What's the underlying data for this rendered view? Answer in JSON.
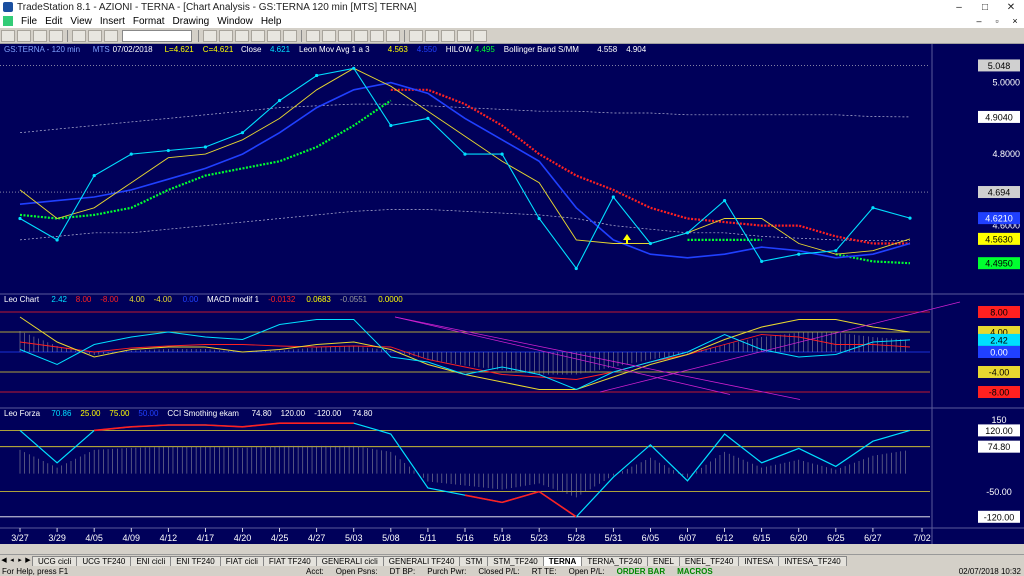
{
  "window": {
    "title": "TradeStation 8.1 - AZIONI - TERNA - [Chart Analysis - GS:TERNA  120 min  [MTS] TERNA]",
    "buttons": [
      "–",
      "□",
      "✕"
    ]
  },
  "menu": [
    "File",
    "Edit",
    "View",
    "Insert",
    "Format",
    "Drawing",
    "Window",
    "Help"
  ],
  "mdi_buttons": [
    "–",
    "▫",
    "×"
  ],
  "colors": {
    "background": "#00005a",
    "price": "#00e0ff",
    "green": "#00ff30",
    "red": "#ff2020",
    "blue": "#2040ff",
    "yellow": "#e8d830",
    "magenta": "#d020d0",
    "axis_text": "#ffffff"
  },
  "legends": {
    "price": [
      {
        "text": "GS:TERNA - 120 min",
        "color": "#7fa0ff"
      },
      {
        "text": "MTS",
        "color": "#7fa0ff"
      },
      {
        "text": "07/02/2018",
        "color": "#ffffff"
      },
      {
        "text": "L=4.621",
        "color": "#ffff00"
      },
      {
        "text": "C=4.621",
        "color": "#ffff00"
      },
      {
        "text": "Close",
        "color": "#ffffff"
      },
      {
        "text": "4.621",
        "color": "#00e0ff"
      },
      {
        "text": "Leon Mov Avg 1 a 3",
        "color": "#ffffff"
      },
      {
        "text": "4.563",
        "color": "#ffff00"
      },
      {
        "text": "4.550",
        "color": "#2040ff"
      },
      {
        "text": "HILOW",
        "color": "#ffffff"
      },
      {
        "text": "4.495",
        "color": "#00ff30"
      },
      {
        "text": "Bollinger Band S/MM",
        "color": "#ffffff"
      },
      {
        "text": "4.558",
        "color": "#ffffff"
      },
      {
        "text": "4.904",
        "color": "#ffffff"
      }
    ],
    "leo_chart": [
      {
        "text": "Leo Chart",
        "color": "#ffffff"
      },
      {
        "text": "2.42",
        "color": "#00e0ff"
      },
      {
        "text": "8.00",
        "color": "#ff2020"
      },
      {
        "text": "-8.00",
        "color": "#ff2020"
      },
      {
        "text": "4.00",
        "color": "#e8d830"
      },
      {
        "text": "-4.00",
        "color": "#e8d830"
      },
      {
        "text": "0.00",
        "color": "#2040ff"
      },
      {
        "text": "MACD modif 1",
        "color": "#ffffff"
      },
      {
        "text": "-0.0132",
        "color": "#ff2020"
      },
      {
        "text": "0.0683",
        "color": "#ffff00"
      },
      {
        "text": "-0.0551",
        "color": "#9a9a9a"
      },
      {
        "text": "0.0000",
        "color": "#ffff00"
      }
    ],
    "leo_forza": [
      {
        "text": "Leo Forza",
        "color": "#ffffff"
      },
      {
        "text": "70.86",
        "color": "#00e0ff"
      },
      {
        "text": "25.00",
        "color": "#ffff00"
      },
      {
        "text": "75.00",
        "color": "#ffff00"
      },
      {
        "text": "50.00",
        "color": "#2040ff"
      },
      {
        "text": "CCI Smothing ekam",
        "color": "#ffffff"
      },
      {
        "text": "74.80",
        "color": "#ffffff"
      },
      {
        "text": "120.00",
        "color": "#ffffff"
      },
      {
        "text": "-120.00",
        "color": "#ffffff"
      },
      {
        "text": "74.80",
        "color": "#ffffff"
      }
    ]
  },
  "price_axis": [
    "5.0000",
    "4.8000",
    "4.7000"
  ],
  "price_axis_extra": [
    "4.6000"
  ],
  "price_marks": [
    {
      "text": "5.048",
      "color": "#000000",
      "bg": "#d0d0d0",
      "y": 5.048
    },
    {
      "text": "4.694",
      "color": "#000000",
      "bg": "#d0d0d0",
      "y": 4.694
    },
    {
      "text": "4.9040",
      "color": "#000000",
      "bg": "#ffffff",
      "y": 4.904
    },
    {
      "text": "4.6210",
      "color": "#ffffff",
      "bg": "#2040ff",
      "y": 4.621
    },
    {
      "text": "4.5630",
      "color": "#000000",
      "bg": "#ffff00",
      "y": 4.563
    },
    {
      "text": "4.4950",
      "color": "#000000",
      "bg": "#00ff30",
      "y": 4.495
    }
  ],
  "leo_axis_marks": [
    {
      "text": "8.00",
      "color": "#000000",
      "bg": "#ff2020",
      "y": 8
    },
    {
      "text": "4.00",
      "color": "#000000",
      "bg": "#e8d830",
      "y": 4
    },
    {
      "text": "2.42",
      "color": "#000000",
      "bg": "#00e0ff",
      "y": 2.42
    },
    {
      "text": "0.00",
      "color": "#ffffff",
      "bg": "#2040ff",
      "y": 0
    },
    {
      "text": "-4.00",
      "color": "#000000",
      "bg": "#e8d830",
      "y": -4
    },
    {
      "text": "-8.00",
      "color": "#000000",
      "bg": "#ff2020",
      "y": -8
    }
  ],
  "forza_axis_marks": [
    {
      "text": "150",
      "color": "#ffffff",
      "bg": "",
      "y": 150
    },
    {
      "text": "120.00",
      "color": "#000000",
      "bg": "#ffffff",
      "y": 120
    },
    {
      "text": "74.80",
      "color": "#000000",
      "bg": "#ffffff",
      "y": 74.8
    },
    {
      "text": "-50.00",
      "color": "#ffffff",
      "bg": "",
      "y": -50
    },
    {
      "text": "-120.00",
      "color": "#000000",
      "bg": "#ffffff",
      "y": -120
    }
  ],
  "dates": [
    "3/27",
    "3/29",
    "4/05",
    "4/09",
    "4/12",
    "4/17",
    "4/20",
    "4/25",
    "4/27",
    "5/03",
    "5/08",
    "5/11",
    "5/16",
    "5/18",
    "5/23",
    "5/28",
    "5/31",
    "6/05",
    "6/07",
    "6/12",
    "6/15",
    "6/20",
    "6/25",
    "6/27",
    "7/02"
  ],
  "tabs": [
    "UCG cicli",
    "UCG TF240",
    "ENI cicli",
    "ENI TF240",
    "FIAT cicli",
    "FIAT TF240",
    "GENERALI cicli",
    "GENERALI TF240",
    "STM",
    "STM_TF240",
    "TERNA",
    "TERNA_TF240",
    "ENEL",
    "ENEL_TF240",
    "INTESA",
    "INTESA_TF240"
  ],
  "active_tab": "TERNA",
  "status": {
    "help": "For Help, press F1",
    "fields": [
      "Acct:",
      "Open Psns:",
      "DT BP:",
      "Purch Pwr:",
      "Closed P/L:",
      "RT TE:",
      "Open P/L:"
    ],
    "order_bar": "ORDER BAR",
    "macros": "MACROS",
    "clock": "02/07/2018 10:32"
  },
  "chart_data": [
    {
      "type": "line",
      "title": "GS:TERNA - 120 min",
      "x": [
        "3/27",
        "3/29",
        "4/05",
        "4/09",
        "4/12",
        "4/17",
        "4/20",
        "4/25",
        "4/27",
        "5/03",
        "5/08",
        "5/11",
        "5/16",
        "5/18",
        "5/23",
        "5/28",
        "5/31",
        "6/05",
        "6/07",
        "6/12",
        "6/15",
        "6/20",
        "6/25",
        "6/27",
        "7/02"
      ],
      "ylim": [
        4.42,
        5.08
      ],
      "series": [
        {
          "name": "Close",
          "values": [
            4.62,
            4.56,
            4.74,
            4.8,
            4.81,
            4.82,
            4.86,
            4.95,
            5.02,
            5.04,
            4.88,
            4.9,
            4.8,
            4.8,
            4.62,
            4.48,
            4.68,
            4.55,
            4.58,
            4.67,
            4.5,
            4.52,
            4.53,
            4.65,
            4.621
          ]
        },
        {
          "name": "Leon Mov Avg 1 a 3",
          "values": [
            4.7,
            4.62,
            4.65,
            4.72,
            4.79,
            4.8,
            4.84,
            4.9,
            4.98,
            5.04,
            4.99,
            4.92,
            4.85,
            4.78,
            4.72,
            4.56,
            4.55,
            4.55,
            4.58,
            4.62,
            4.62,
            4.55,
            4.52,
            4.53,
            4.563
          ]
        },
        {
          "name": "Leon Mov Avg 1 a 3",
          "values": [
            4.66,
            4.67,
            4.68,
            4.7,
            4.73,
            4.76,
            4.8,
            4.86,
            4.93,
            4.98,
            5.0,
            4.97,
            4.9,
            4.84,
            4.78,
            4.65,
            4.56,
            4.52,
            4.51,
            4.52,
            4.54,
            4.53,
            4.51,
            4.52,
            4.55
          ]
        },
        {
          "name": "HILOW",
          "values": [
            4.63,
            4.62,
            4.63,
            4.65,
            4.7,
            4.74,
            4.76,
            4.78,
            4.82,
            4.88,
            4.95,
            null,
            null,
            null,
            null,
            null,
            null,
            null,
            4.56,
            4.56,
            4.56,
            null,
            4.52,
            4.5,
            4.495
          ]
        },
        {
          "name": "HILOW",
          "values": [
            null,
            null,
            null,
            null,
            null,
            null,
            null,
            null,
            null,
            null,
            4.98,
            4.98,
            4.94,
            4.88,
            4.8,
            4.74,
            4.7,
            4.65,
            4.62,
            4.61,
            4.6,
            4.6,
            4.57,
            4.55,
            4.55
          ]
        },
        {
          "name": "Bollinger Band S/MM",
          "values": [
            4.86,
            4.87,
            4.88,
            4.89,
            4.9,
            4.91,
            4.92,
            4.93,
            4.935,
            4.94,
            4.94,
            4.935,
            4.93,
            4.925,
            4.92,
            4.92,
            4.915,
            4.915,
            4.91,
            4.91,
            4.91,
            4.91,
            4.91,
            4.905,
            4.904
          ]
        },
        {
          "name": "Bollinger Band S/MM",
          "values": [
            4.56,
            4.57,
            4.58,
            4.58,
            4.59,
            4.6,
            4.61,
            4.62,
            4.63,
            4.64,
            4.645,
            4.645,
            4.64,
            4.635,
            4.63,
            4.62,
            4.6,
            4.59,
            4.58,
            4.58,
            4.57,
            4.565,
            4.56,
            4.558,
            4.558
          ]
        }
      ]
    },
    {
      "type": "line",
      "title": "Leo Chart",
      "x": [
        "3/27",
        "3/29",
        "4/05",
        "4/09",
        "4/12",
        "4/17",
        "4/20",
        "4/25",
        "4/27",
        "5/03",
        "5/08",
        "5/11",
        "5/16",
        "5/18",
        "5/23",
        "5/28",
        "5/31",
        "6/05",
        "6/07",
        "6/12",
        "6/15",
        "6/20",
        "6/25",
        "6/27",
        "7/02"
      ],
      "ylim": [
        -10,
        10
      ],
      "series": [
        {
          "name": "Leo Chart",
          "values": [
            0.5,
            -2.5,
            1.5,
            3.0,
            4.0,
            3.0,
            2.5,
            5.5,
            6.5,
            6.5,
            -1.0,
            -2.0,
            -4.5,
            -3.0,
            -4.5,
            -7.5,
            -4.0,
            -2.0,
            0.0,
            3.5,
            0.5,
            -1.0,
            -0.5,
            2.0,
            2.42
          ]
        },
        {
          "name": "MACD modif 1",
          "values": [
            7.0,
            2.0,
            -1.0,
            0.5,
            1.0,
            1.0,
            0.0,
            0.5,
            1.5,
            2.0,
            0.5,
            -2.5,
            -4.5,
            -6.0,
            -7.5,
            -7.5,
            -5.0,
            -2.5,
            -0.5,
            2.5,
            5.0,
            6.5,
            6.5,
            5.0,
            4.0
          ]
        },
        {
          "name": "MACD modif 1",
          "values": [
            2.0,
            1.0,
            0.0,
            0.8,
            1.2,
            1.5,
            1.5,
            1.2,
            1.0,
            1.2,
            1.0,
            -1.5,
            -3.0,
            -4.5,
            -5.0,
            -5.5,
            -4.0,
            -2.0,
            -0.5,
            1.5,
            3.5,
            3.0,
            1.5,
            1.5,
            1.0
          ]
        }
      ]
    },
    {
      "type": "line",
      "title": "Leo Forza",
      "x": [
        "3/27",
        "3/29",
        "4/05",
        "4/09",
        "4/12",
        "4/17",
        "4/20",
        "4/25",
        "4/27",
        "5/03",
        "5/08",
        "5/11",
        "5/16",
        "5/18",
        "5/23",
        "5/28",
        "5/31",
        "6/05",
        "6/07",
        "6/12",
        "6/15",
        "6/20",
        "6/25",
        "6/27",
        "7/02"
      ],
      "ylim": [
        -140,
        160
      ],
      "series": [
        {
          "name": "Leo Forza",
          "values": [
            120,
            30,
            120,
            130,
            135,
            135,
            130,
            140,
            140,
            140,
            110,
            -40,
            -60,
            -80,
            -50,
            -120,
            -10,
            80,
            -20,
            110,
            30,
            70,
            20,
            90,
            120
          ]
        }
      ]
    }
  ]
}
